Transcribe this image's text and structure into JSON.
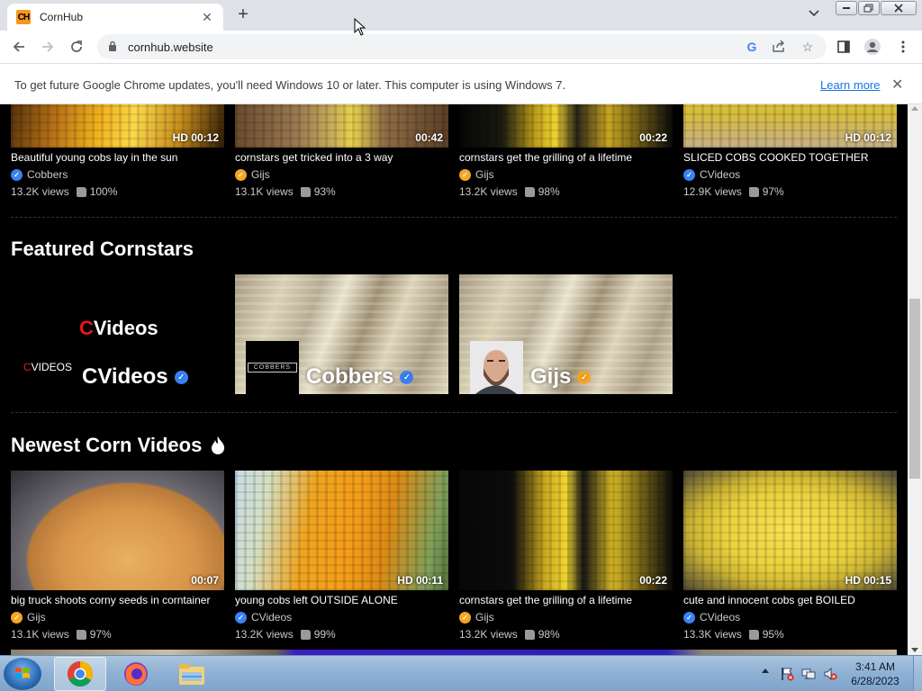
{
  "browser": {
    "tab_title": "CornHub",
    "favicon_text": "CH",
    "url": "cornhub.website",
    "new_tab_symbol": "+",
    "info_bar": {
      "text": "To get future Google Chrome updates, you'll need Windows 10 or later. This computer is using Windows 7.",
      "link": "Learn more"
    }
  },
  "sections": {
    "featured_title": "Featured Cornstars",
    "newest_title": "Newest Corn Videos"
  },
  "top_videos": [
    {
      "title": "Beautiful young cobs lay in the sun",
      "duration": "HD 00:12",
      "channel": "Cobbers",
      "badge": "blue",
      "views": "13.2K views",
      "rating": "100%"
    },
    {
      "title": "cornstars get tricked into a 3 way",
      "duration": "00:42",
      "channel": "Gijs",
      "badge": "gold",
      "views": "13.1K views",
      "rating": "93%"
    },
    {
      "title": "cornstars get the grilling of a lifetime",
      "duration": "00:22",
      "channel": "Gijs",
      "badge": "gold",
      "views": "13.2K views",
      "rating": "98%"
    },
    {
      "title": "SLICED COBS COOKED TOGETHER",
      "duration": "HD 00:12",
      "channel": "CVideos",
      "badge": "blue",
      "views": "12.9K views",
      "rating": "97%"
    }
  ],
  "featured": [
    {
      "name": "CVideos",
      "badge": "blue",
      "logo_big": "Videos",
      "logo_small": "VIDEOS",
      "logo_initial": "C"
    },
    {
      "name": "Cobbers",
      "badge": "blue",
      "avatar_text": "COBBERS"
    },
    {
      "name": "Gijs",
      "badge": "gold"
    }
  ],
  "newest_videos": [
    {
      "title": "big truck shoots corny seeds in corntainer",
      "duration": "00:07",
      "channel": "Gijs",
      "badge": "gold",
      "views": "13.1K views",
      "rating": "97%"
    },
    {
      "title": "young cobs left OUTSIDE ALONE",
      "duration": "HD 00:11",
      "channel": "CVideos",
      "badge": "blue",
      "views": "13.2K views",
      "rating": "99%"
    },
    {
      "title": "cornstars get the grilling of a lifetime",
      "duration": "00:22",
      "channel": "Gijs",
      "badge": "gold",
      "views": "13.2K views",
      "rating": "98%"
    },
    {
      "title": "cute and innocent cobs get BOILED",
      "duration": "HD 00:15",
      "channel": "CVideos",
      "badge": "blue",
      "views": "13.3K views",
      "rating": "95%"
    }
  ],
  "taskbar": {
    "time": "3:41 AM",
    "date": "6/28/2023",
    "apps": [
      "chrome-icon",
      "firefox-icon",
      "explorer-icon"
    ]
  },
  "colors": {
    "verified_blue": "#3a82f7",
    "verified_gold": "#f5a623",
    "brand_orange": "#f7971d",
    "cvideos_red": "#e8151b"
  }
}
